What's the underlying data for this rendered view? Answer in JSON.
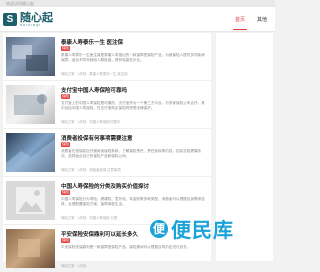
{
  "topbar": {
    "text": "欢迎访问随心起"
  },
  "logo": {
    "mark": "S",
    "cn": "随心起",
    "en": "SUIXINQI"
  },
  "nav": {
    "home": "首页",
    "item2": "其他"
  },
  "articles": [
    {
      "title": "泰康人寿泰乐一生 医注保",
      "tag": "保险",
      "excerpt": "泰康人寿泰乐一生医注保是泰康人寿推出的一款保障型保险产品，为被保险人提供多项疾病保障，适合不同年龄段人群投保，具有较高性价比。",
      "meta": "保险之家 · 1天前 · 泰康人寿泰乐一生 医注保"
    },
    {
      "title": "支付宝中国人寿保险可靠吗",
      "tag": "保险",
      "excerpt": "支付宝上的中国人寿保险是可靠的，支付宝作为一个第三方平台，与多家保险公司合作，其中包括中国人寿保险，在支付宝购买保险同样受法律保护。",
      "meta": "保险之家 · 1天前 · 中国人寿保险可靠吗"
    },
    {
      "title": "消费者投保有何事项需要注意",
      "tag": "保险",
      "excerpt": "消费者在投保前应仔细阅读保险条款，了解保险责任、责任免除等内容，如实告知健康状况，选择适合自己的保险产品和保险公司。",
      "meta": "保险之家 · 1天前 · 消费者投保 注意事项"
    },
    {
      "title": "中国人寿保险的分类及购买价值探讨",
      "tag": "保险",
      "excerpt": "中国人寿保险分为寿险、健康险、意外险、年金险等多种类型，消费者可以根据自身需求选择，合理配置保险方案，保障家庭生活。",
      "meta": "保险之家 · 1天前 · 中国人寿保险 分类"
    },
    {
      "title": "平安保险安保鼎利可以延长多久",
      "tag": "保险",
      "excerpt": "平安保险安保鼎利是一款保障型保险产品，保险期间可以根据合同约定进行延长。",
      "meta": "保险之家 · 1天前"
    }
  ],
  "watermark": {
    "mark": "便",
    "text": "便民库"
  }
}
